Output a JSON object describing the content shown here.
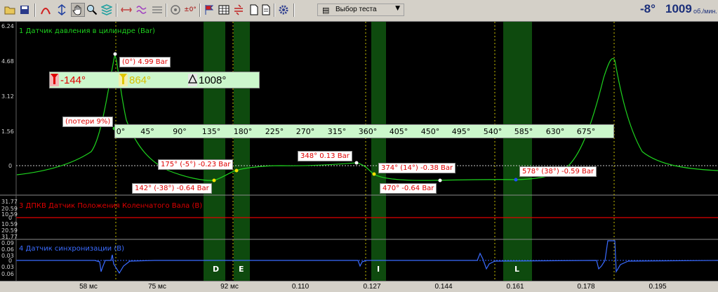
{
  "toolbar": {
    "icons": [
      "open-folder-icon",
      "save-disk-icon",
      "cursor-measure-icon",
      "resize-icon",
      "hand-pan-icon",
      "zoom-in-icon",
      "layers-icon",
      "stretch-icon",
      "waves-icon",
      "stats-icon",
      "wheel-icon",
      "degree-icon",
      "flag-icon",
      "table-icon",
      "sync-icon",
      "document-icon",
      "gear-icon"
    ],
    "test_select": "Выбор теста",
    "angle": "-8°",
    "rpm": "1009",
    "rpm_unit": "об./мин."
  },
  "channels": {
    "pressure": {
      "title": "1 Датчик давления в цилиндре (Bar)",
      "y_labels": [
        "6.24",
        "4.68",
        "3.12",
        "1.56",
        "0"
      ],
      "color": "#00c000"
    },
    "dpkv": {
      "title": "3 ДПКВ Датчик Положения Коленчатого Вала (В)",
      "y_labels": [
        "31.77",
        "20.59",
        "10.59",
        "0",
        "10.59",
        "20.59",
        "31.77"
      ],
      "color": "#e00000"
    },
    "sync": {
      "title": "4 Датчик синхронизации (В)",
      "y_labels": [
        "0.09",
        "0.06",
        "0.03",
        "0",
        "0.03",
        "0.06"
      ],
      "color": "#2050ff"
    }
  },
  "cursors": {
    "red": "-144°",
    "yellow": "864°",
    "delta": "1008°"
  },
  "degree_ruler": [
    "0°",
    "45°",
    "90°",
    "135°",
    "180°",
    "225°",
    "270°",
    "315°",
    "360°",
    "405°",
    "450°",
    "495°",
    "540°",
    "585°",
    "630°",
    "675°"
  ],
  "annotations": {
    "peak": "(0°) 4.99 Bar",
    "loss": "(потери 9%)",
    "p142": "142° (-38°) -0.64 Bar",
    "p175": "175° (-5°) -0.23 Bar",
    "p348": "348° 0.13 Bar",
    "p374": "374° (14°) -0.38 Bar",
    "p470": "470° -0.64 Bar",
    "p578": "578° (38°) -0.59 Bar"
  },
  "zones": [
    "D",
    "E",
    "I",
    "L"
  ],
  "time_axis": [
    "58 мс",
    "75 мс",
    "92 мс",
    "0.110",
    "0.127",
    "0.144",
    "0.161",
    "0.178",
    "0.195"
  ],
  "chart_data": {
    "type": "line",
    "series": [
      {
        "name": "1 Датчик давления в цилиндре (Bar)",
        "x_deg": [
          -144,
          -120,
          -90,
          -60,
          -30,
          -15,
          0,
          15,
          30,
          60,
          90,
          120,
          142,
          175,
          210,
          270,
          348,
          374,
          410,
          470,
          520,
          578,
          620,
          660,
          690,
          720,
          735,
          750,
          780,
          820,
          864
        ],
        "values": [
          0.12,
          0.25,
          0.45,
          0.85,
          1.75,
          3.1,
          4.99,
          2.9,
          1.45,
          0.4,
          -0.2,
          -0.55,
          -0.64,
          -0.23,
          -0.05,
          0.05,
          0.13,
          -0.38,
          -0.6,
          -0.64,
          -0.62,
          -0.59,
          -0.5,
          -0.2,
          0.3,
          1.6,
          3.2,
          4.6,
          2.0,
          0.6,
          0.05
        ]
      }
    ],
    "ylim": [
      -0.64,
      6.24
    ],
    "xlabel": "",
    "ylabel": ""
  }
}
